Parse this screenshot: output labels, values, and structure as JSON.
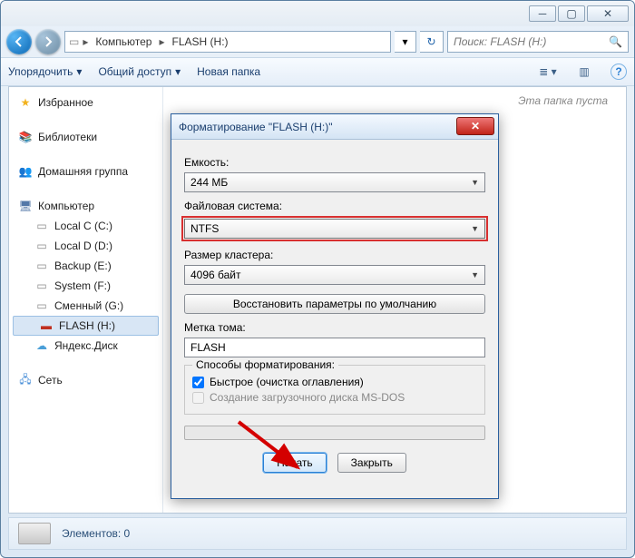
{
  "breadcrumb": {
    "seg1": "Компьютер",
    "seg2": "FLASH (H:)"
  },
  "search": {
    "placeholder": "Поиск: FLASH (H:)"
  },
  "toolbar": {
    "organize": "Упорядочить",
    "share": "Общий доступ",
    "newfolder": "Новая папка"
  },
  "sidebar": {
    "favorites": "Избранное",
    "libraries": "Библиотеки",
    "homegroup": "Домашняя группа",
    "computer": "Компьютер",
    "drives": {
      "c": "Local C (C:)",
      "d": "Local D (D:)",
      "e": "Backup (E:)",
      "f": "System (F:)",
      "g": "Сменный (G:)",
      "h": "FLASH (H:)",
      "yd": "Яндекс.Диск"
    },
    "network": "Сеть"
  },
  "content": {
    "empty": "Эта папка пуста"
  },
  "status": {
    "elements_label": "Элементов:",
    "elements_count": "0"
  },
  "dialog": {
    "title": "Форматирование \"FLASH (H:)\"",
    "capacity_label": "Емкость:",
    "capacity_value": "244 МБ",
    "fs_label": "Файловая система:",
    "fs_value": "NTFS",
    "cluster_label": "Размер кластера:",
    "cluster_value": "4096 байт",
    "restore": "Восстановить параметры по умолчанию",
    "volume_label": "Метка тома:",
    "volume_value": "FLASH",
    "methods_label": "Способы форматирования:",
    "quick": "Быстрое (очистка оглавления)",
    "msdos": "Создание загрузочного диска MS-DOS",
    "start": "Начать",
    "close": "Закрыть"
  }
}
